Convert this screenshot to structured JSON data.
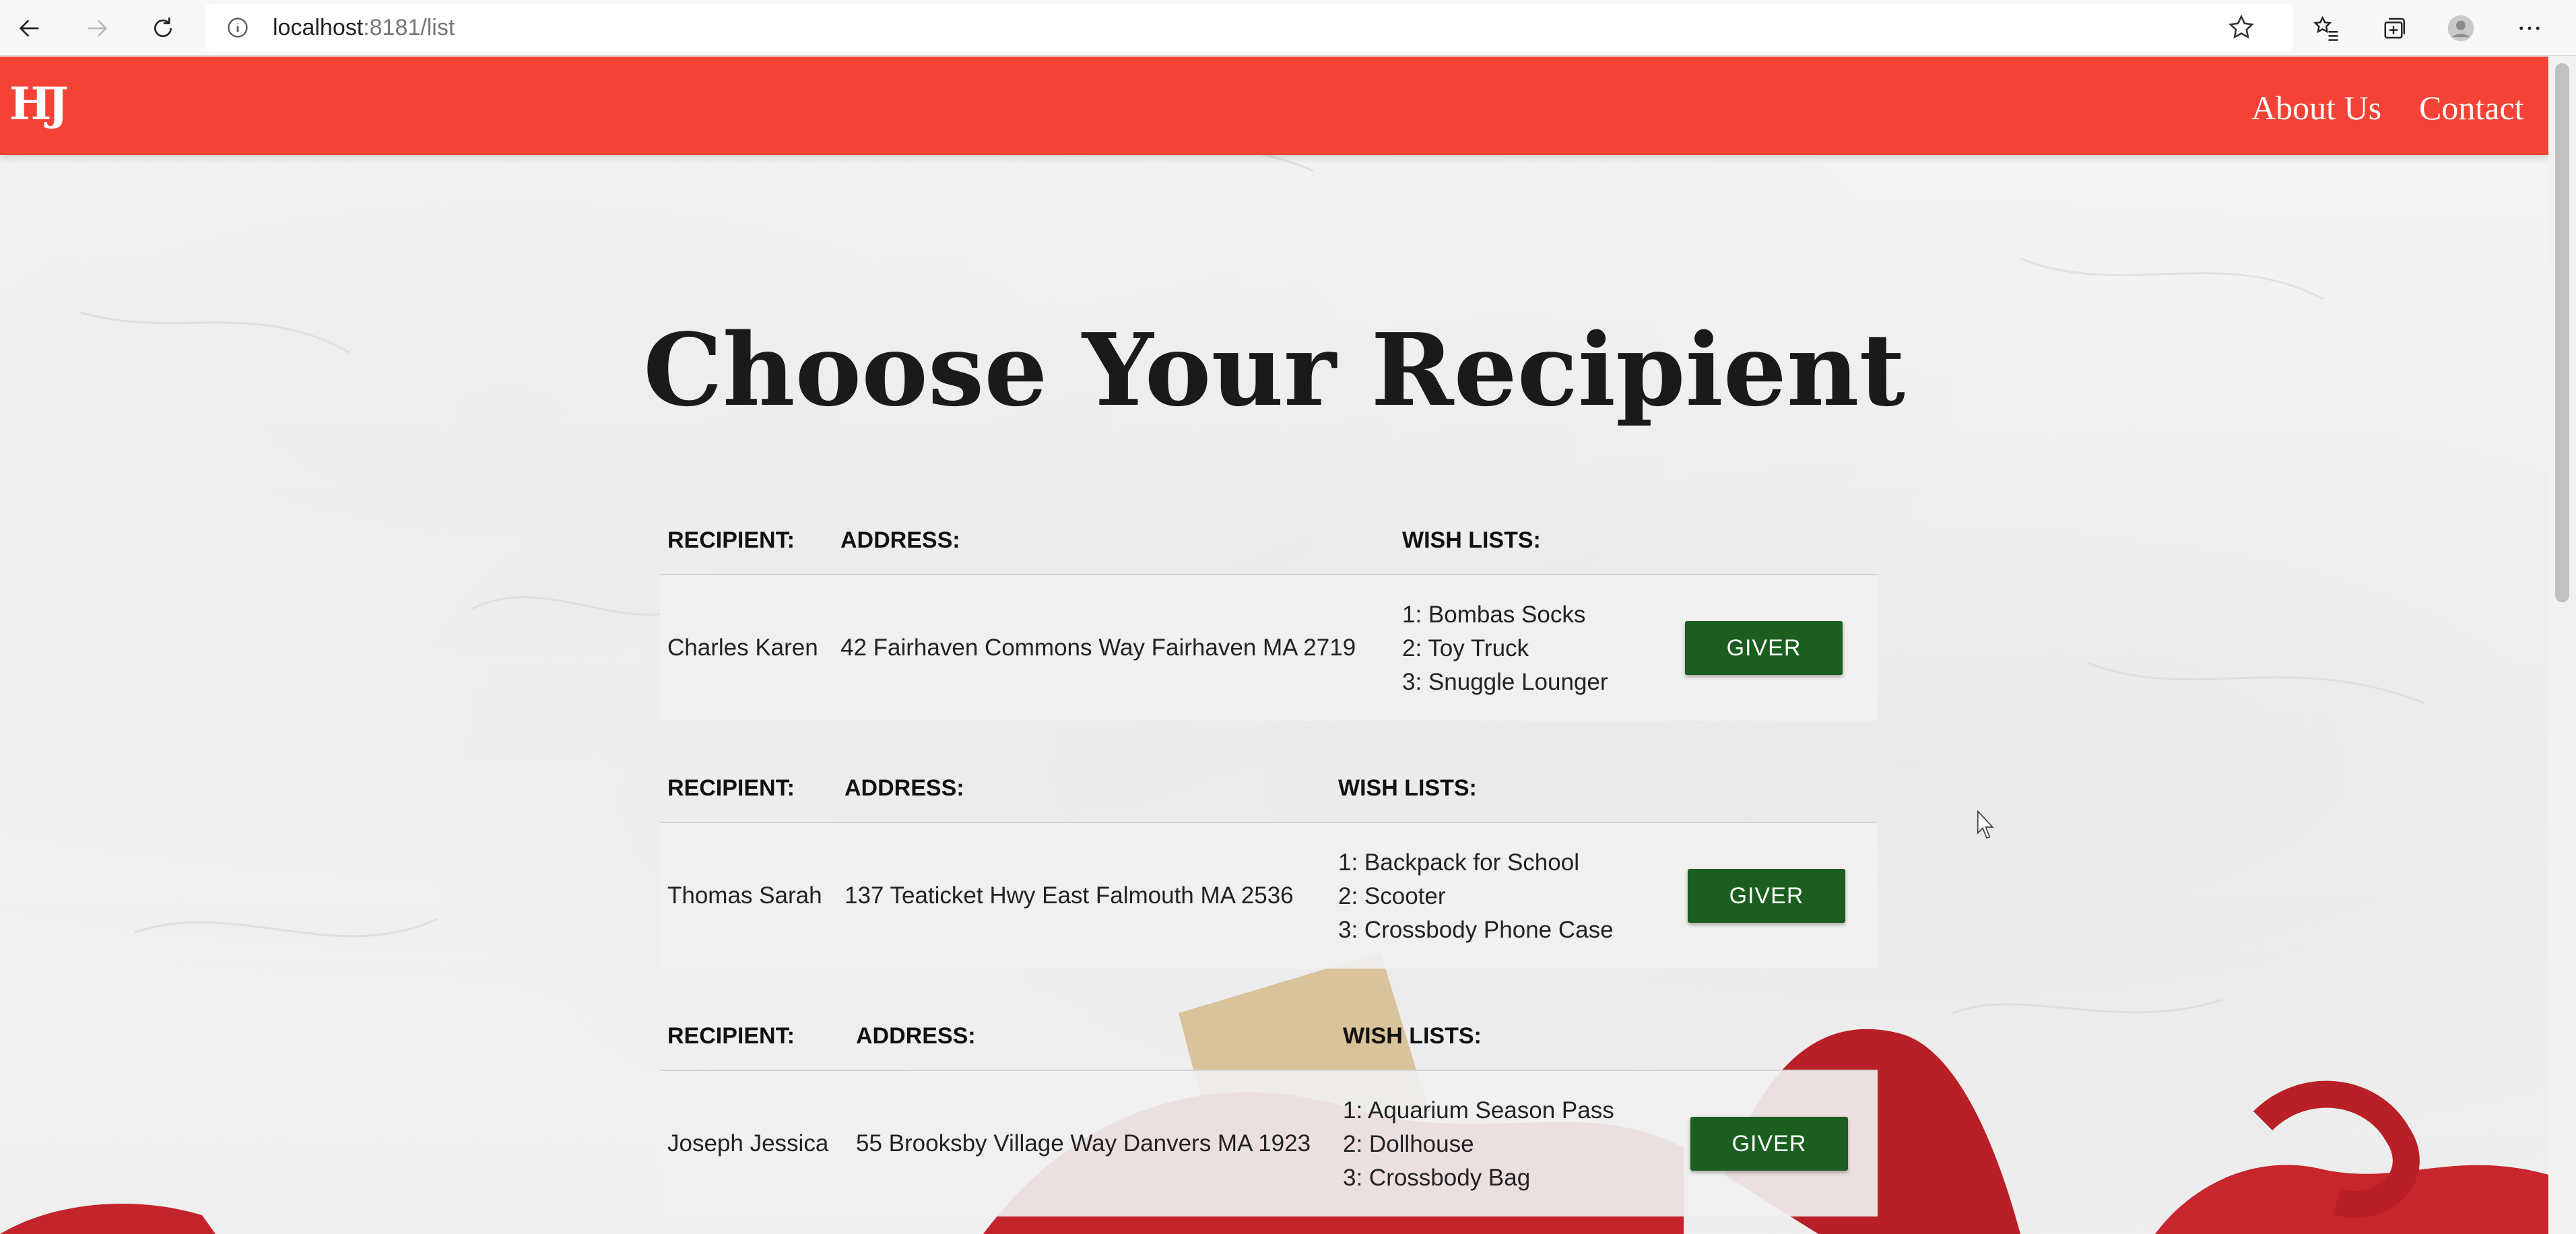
{
  "browser": {
    "url_host": "localhost",
    "url_rest": ":8181/list",
    "icons": [
      "back-icon",
      "forward-icon",
      "refresh-icon",
      "info-icon",
      "star-icon",
      "favorites-icon",
      "collections-icon",
      "profile-icon",
      "more-icon"
    ]
  },
  "header": {
    "logo": "HJ",
    "nav": [
      {
        "label": "About Us"
      },
      {
        "label": "Contact"
      }
    ],
    "color": "#f44336"
  },
  "page": {
    "title": "Choose Your Recipient"
  },
  "table": {
    "headers": {
      "recipient": "RECIPIENT:",
      "address": "ADDRESS:",
      "wish_lists": "WISH LISTS:"
    },
    "button_label": "GIVER",
    "button_color": "#1b5e20",
    "rows": [
      {
        "recipient": "Charles Karen",
        "address": "42 Fairhaven Commons Way Fairhaven MA 2719",
        "wishes": [
          "1: Bombas Socks",
          "2: Toy Truck",
          "3: Snuggle Lounger"
        ]
      },
      {
        "recipient": "Thomas Sarah",
        "address": "137 Teaticket Hwy East Falmouth MA 2536",
        "wishes": [
          "1: Backpack for School",
          "2: Scooter",
          "3: Crossbody Phone Case"
        ]
      },
      {
        "recipient": "Joseph Jessica",
        "address": "55 Brooksby Village Way Danvers MA 1923",
        "wishes": [
          "1: Aquarium Season Pass",
          "2: Dollhouse",
          "3: Crossbody Bag"
        ]
      }
    ]
  }
}
